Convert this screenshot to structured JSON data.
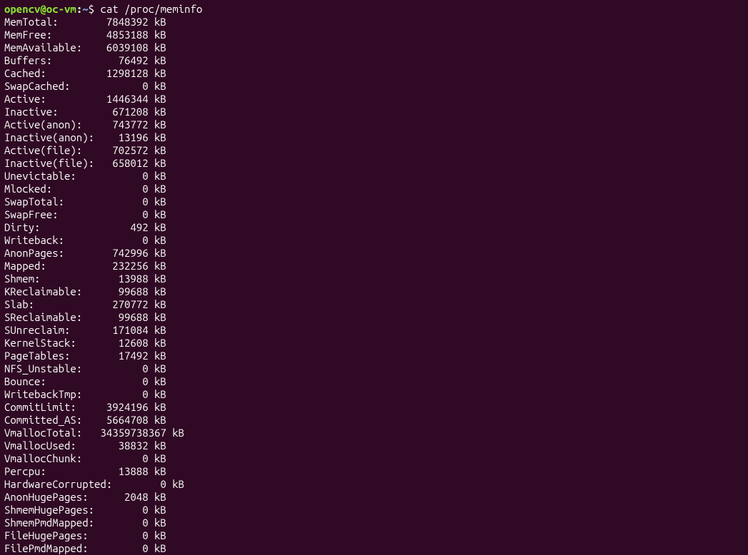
{
  "prompt": {
    "user_host": "opencv@oc-vm",
    "separator": ":",
    "path": "~",
    "symbol": "$",
    "command": "cat /proc/meminfo"
  },
  "meminfo": [
    {
      "label": "MemTotal:",
      "value": "7848392",
      "unit": "kB"
    },
    {
      "label": "MemFree:",
      "value": "4853188",
      "unit": "kB"
    },
    {
      "label": "MemAvailable:",
      "value": "6039108",
      "unit": "kB"
    },
    {
      "label": "Buffers:",
      "value": "76492",
      "unit": "kB"
    },
    {
      "label": "Cached:",
      "value": "1298128",
      "unit": "kB"
    },
    {
      "label": "SwapCached:",
      "value": "0",
      "unit": "kB"
    },
    {
      "label": "Active:",
      "value": "1446344",
      "unit": "kB"
    },
    {
      "label": "Inactive:",
      "value": "671208",
      "unit": "kB"
    },
    {
      "label": "Active(anon):",
      "value": "743772",
      "unit": "kB"
    },
    {
      "label": "Inactive(anon):",
      "value": "13196",
      "unit": "kB"
    },
    {
      "label": "Active(file):",
      "value": "702572",
      "unit": "kB"
    },
    {
      "label": "Inactive(file):",
      "value": "658012",
      "unit": "kB"
    },
    {
      "label": "Unevictable:",
      "value": "0",
      "unit": "kB"
    },
    {
      "label": "Mlocked:",
      "value": "0",
      "unit": "kB"
    },
    {
      "label": "SwapTotal:",
      "value": "0",
      "unit": "kB"
    },
    {
      "label": "SwapFree:",
      "value": "0",
      "unit": "kB"
    },
    {
      "label": "Dirty:",
      "value": "492",
      "unit": "kB"
    },
    {
      "label": "Writeback:",
      "value": "0",
      "unit": "kB"
    },
    {
      "label": "AnonPages:",
      "value": "742996",
      "unit": "kB"
    },
    {
      "label": "Mapped:",
      "value": "232256",
      "unit": "kB"
    },
    {
      "label": "Shmem:",
      "value": "13988",
      "unit": "kB"
    },
    {
      "label": "KReclaimable:",
      "value": "99688",
      "unit": "kB"
    },
    {
      "label": "Slab:",
      "value": "270772",
      "unit": "kB"
    },
    {
      "label": "SReclaimable:",
      "value": "99688",
      "unit": "kB"
    },
    {
      "label": "SUnreclaim:",
      "value": "171084",
      "unit": "kB"
    },
    {
      "label": "KernelStack:",
      "value": "12608",
      "unit": "kB"
    },
    {
      "label": "PageTables:",
      "value": "17492",
      "unit": "kB"
    },
    {
      "label": "NFS_Unstable:",
      "value": "0",
      "unit": "kB"
    },
    {
      "label": "Bounce:",
      "value": "0",
      "unit": "kB"
    },
    {
      "label": "WritebackTmp:",
      "value": "0",
      "unit": "kB"
    },
    {
      "label": "CommitLimit:",
      "value": "3924196",
      "unit": "kB"
    },
    {
      "label": "Committed_AS:",
      "value": "5664708",
      "unit": "kB"
    },
    {
      "label": "VmallocTotal:",
      "value": "34359738367",
      "unit": "kB"
    },
    {
      "label": "VmallocUsed:",
      "value": "38832",
      "unit": "kB"
    },
    {
      "label": "VmallocChunk:",
      "value": "0",
      "unit": "kB"
    },
    {
      "label": "Percpu:",
      "value": "13888",
      "unit": "kB"
    },
    {
      "label": "HardwareCorrupted:",
      "value": "0",
      "unit": "kB"
    },
    {
      "label": "AnonHugePages:",
      "value": "2048",
      "unit": "kB"
    },
    {
      "label": "ShmemHugePages:",
      "value": "0",
      "unit": "kB"
    },
    {
      "label": "ShmemPmdMapped:",
      "value": "0",
      "unit": "kB"
    },
    {
      "label": "FileHugePages:",
      "value": "0",
      "unit": "kB"
    },
    {
      "label": "FilePmdMapped:",
      "value": "0",
      "unit": "kB"
    }
  ]
}
